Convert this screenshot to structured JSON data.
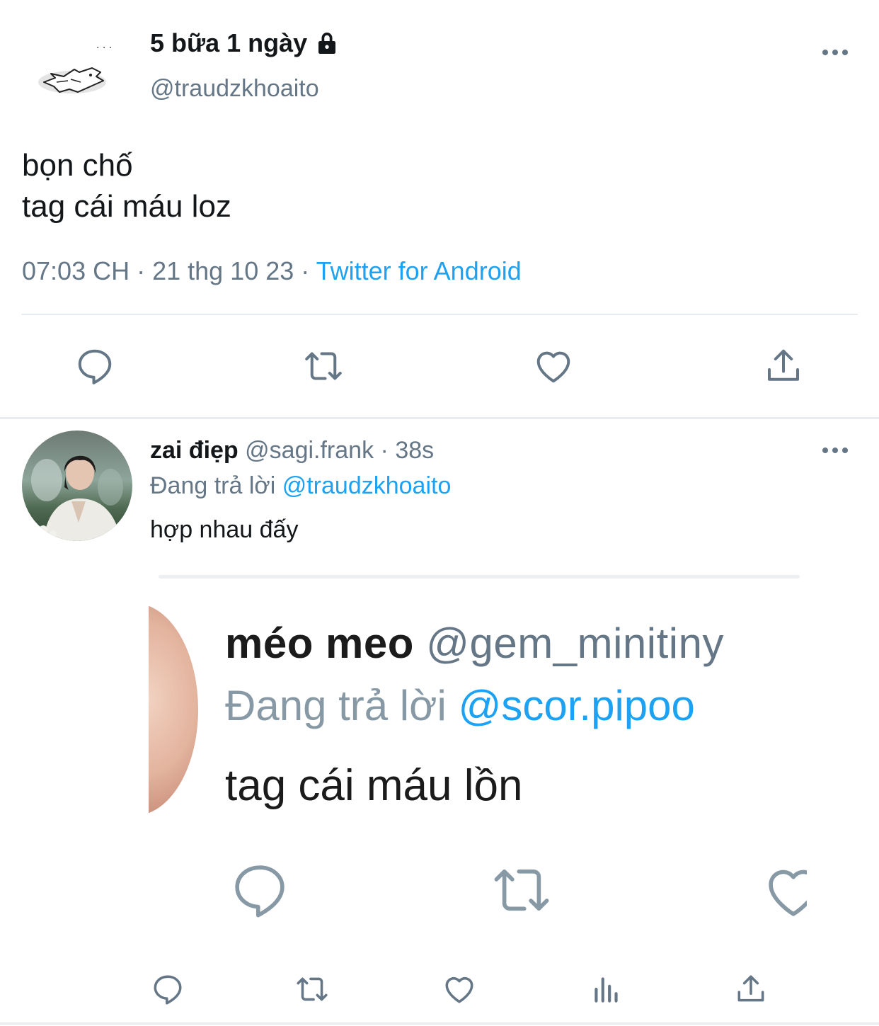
{
  "main_tweet": {
    "display_name": "5 bữa 1 ngày",
    "handle": "@traudzkhoaito",
    "text_lines": [
      "bọn chố",
      "tag cái máu loz"
    ],
    "time": "07:03 CH",
    "date": "21 thg 10 23",
    "source": "Twitter for Android",
    "separator": " · ",
    "icons": {
      "lock": "lock-icon",
      "more": "more-icon",
      "reply": "reply-icon",
      "retweet": "retweet-icon",
      "like": "like-icon",
      "share": "share-icon"
    }
  },
  "reply_tweet": {
    "display_name": "zai điẹp",
    "handle": "@sagi.frank",
    "time": "38s",
    "replying_prefix": "Đang trả lời",
    "replying_to": "@traudzkhoaito",
    "text": "hợp nhau đấy",
    "embedded_screenshot": {
      "display_name": "méo meo",
      "handle": "@gem_minitiny",
      "replying_prefix": "Đang trả lời",
      "replying_to": "@scor.pipoo",
      "text": "tag cái máu lồn"
    },
    "icons": {
      "reply": "reply-icon",
      "retweet": "retweet-icon",
      "like": "like-icon",
      "views": "views-icon",
      "share": "share-icon"
    }
  },
  "colors": {
    "accent": "#1da1f2",
    "secondary_text": "#657786",
    "primary_text": "#14171a",
    "divider": "#e6ecf0",
    "icon": "#657786"
  }
}
